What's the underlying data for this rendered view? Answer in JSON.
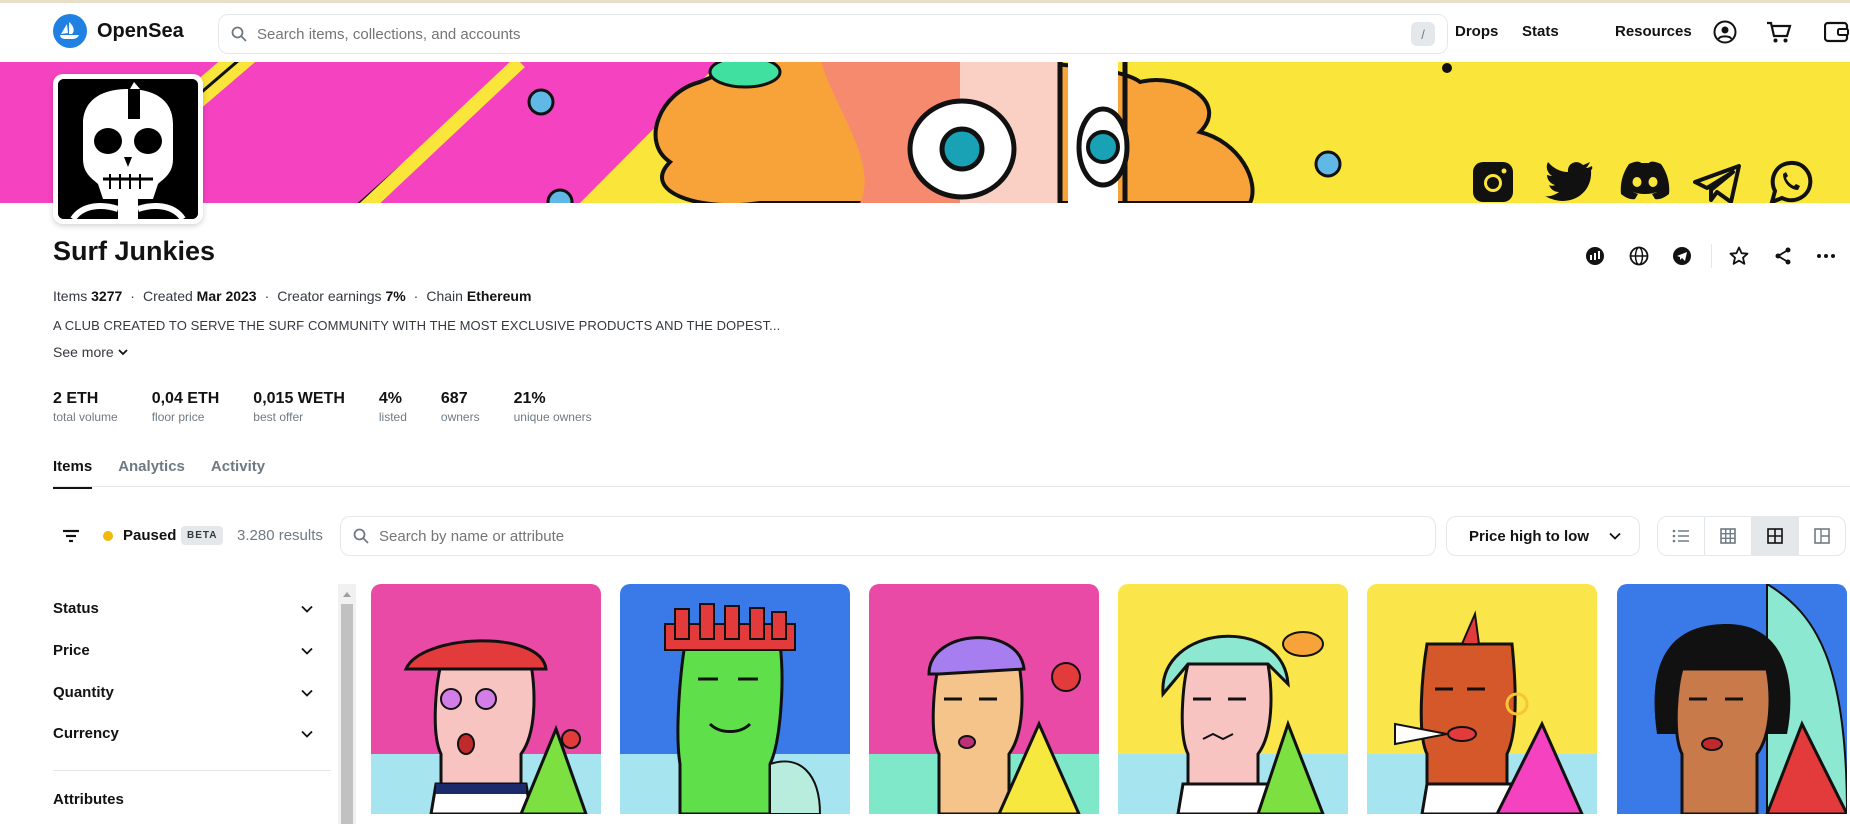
{
  "app": {
    "name": "OpenSea"
  },
  "search": {
    "placeholder": "Search items, collections, and accounts",
    "shortcut": "/"
  },
  "nav": {
    "drops": "Drops",
    "stats": "Stats",
    "resources": "Resources"
  },
  "collection": {
    "name": "Surf Junkies",
    "items_label": "Items",
    "items_value": "3277",
    "created_label": "Created",
    "created_value": "Mar 2023",
    "earnings_label": "Creator earnings",
    "earnings_value": "7%",
    "chain_label": "Chain",
    "chain_value": "Ethereum",
    "description": "A CLUB CREATED TO SERVE THE SURF COMMUNITY WITH THE MOST EXCLUSIVE PRODUCTS AND THE DOPEST...",
    "see_more": "See more"
  },
  "stats": [
    {
      "value": "2 ETH",
      "label": "total volume"
    },
    {
      "value": "0,04 ETH",
      "label": "floor price"
    },
    {
      "value": "0,015 WETH",
      "label": "best offer"
    },
    {
      "value": "4%",
      "label": "listed"
    },
    {
      "value": "687",
      "label": "owners"
    },
    {
      "value": "21%",
      "label": "unique owners"
    }
  ],
  "tabs": [
    {
      "label": "Items",
      "active": true
    },
    {
      "label": "Analytics",
      "active": false
    },
    {
      "label": "Activity",
      "active": false
    }
  ],
  "toolbar": {
    "status_text": "Paused",
    "beta": "BETA",
    "results": "3.280 results",
    "item_search_placeholder": "Search by name or attribute",
    "sort_selected": "Price high to low"
  },
  "filters": [
    {
      "label": "Status"
    },
    {
      "label": "Price"
    },
    {
      "label": "Quantity"
    },
    {
      "label": "Currency"
    },
    {
      "label": "Attributes"
    }
  ],
  "colors": {
    "brand": "#2081e2",
    "paused_dot": "#f0b90b"
  },
  "icons": [
    "search-icon",
    "account-icon",
    "cart-icon",
    "wallet-icon",
    "instagram-icon",
    "twitter-icon",
    "discord-icon",
    "telegram-icon",
    "whatsapp-icon",
    "etherscan-icon",
    "globe-icon",
    "star-icon",
    "share-icon",
    "more-icon",
    "filter-icon",
    "chevron-down-icon",
    "list-view-icon",
    "grid-view-icon"
  ]
}
